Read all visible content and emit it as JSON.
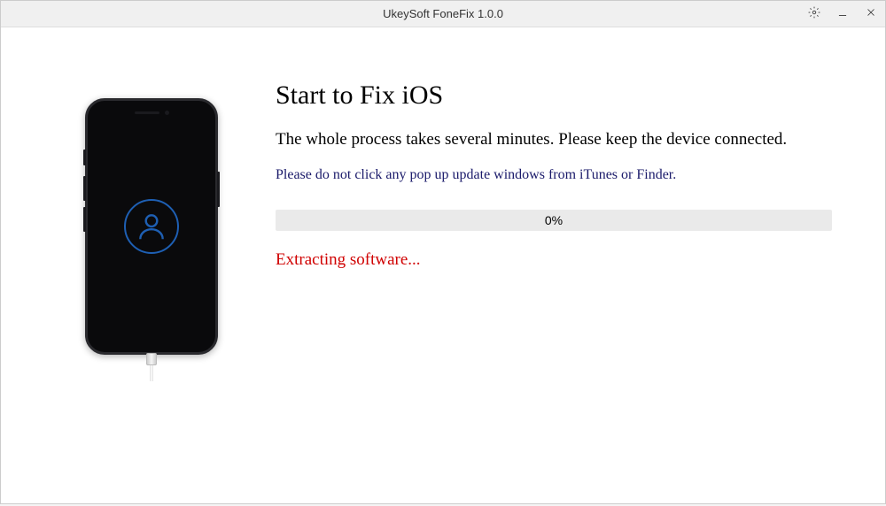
{
  "titlebar": {
    "title": "UkeySoft FoneFix 1.0.0"
  },
  "main": {
    "heading": "Start to Fix iOS",
    "subheading": "The whole process takes several minutes. Please keep the device connected.",
    "warning": "Please do not click any pop up update windows from iTunes or Finder.",
    "progress": {
      "percent": "0%"
    },
    "status": "Extracting software..."
  }
}
